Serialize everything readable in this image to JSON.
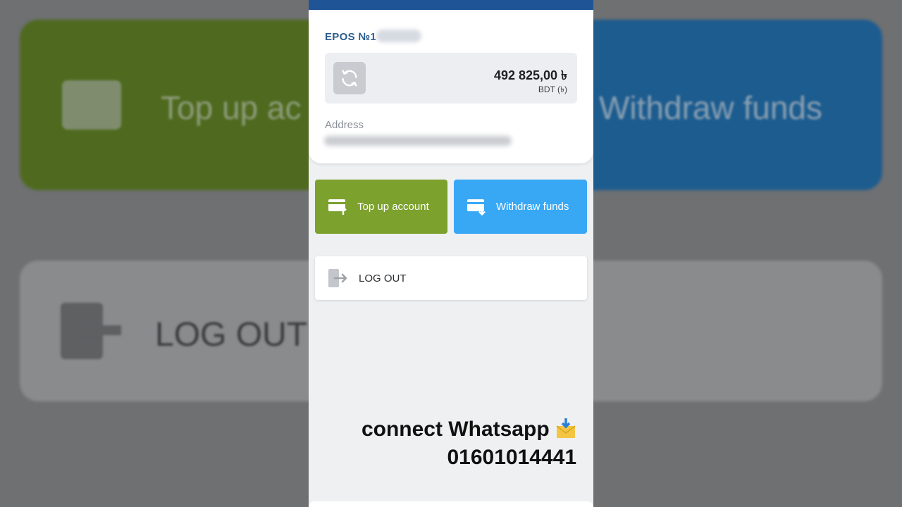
{
  "background": {
    "top_up_text": "Top up ac",
    "withdraw_text": "Withdraw funds",
    "logout_text": "LOG OUT"
  },
  "account": {
    "title": "EPOS №1",
    "balance": "492 825,00 ৳",
    "currency": "BDT (৳)",
    "address_label": "Address"
  },
  "actions": {
    "top_up_label": "Top up account",
    "withdraw_label": "Withdraw funds",
    "logout_label": "LOG OUT"
  },
  "overlay": {
    "line1": "connect Whatsapp",
    "line2": "01601014441"
  },
  "colors": {
    "topbar": "#1f5496",
    "top_up": "#7ca12d",
    "withdraw": "#38a8f5",
    "title": "#2b5c8e"
  },
  "icons": {
    "refresh": "refresh-icon",
    "top_up": "card-upload-icon",
    "withdraw": "card-download-icon",
    "logout": "logout-icon",
    "envelope": "envelope-arrow-icon"
  }
}
